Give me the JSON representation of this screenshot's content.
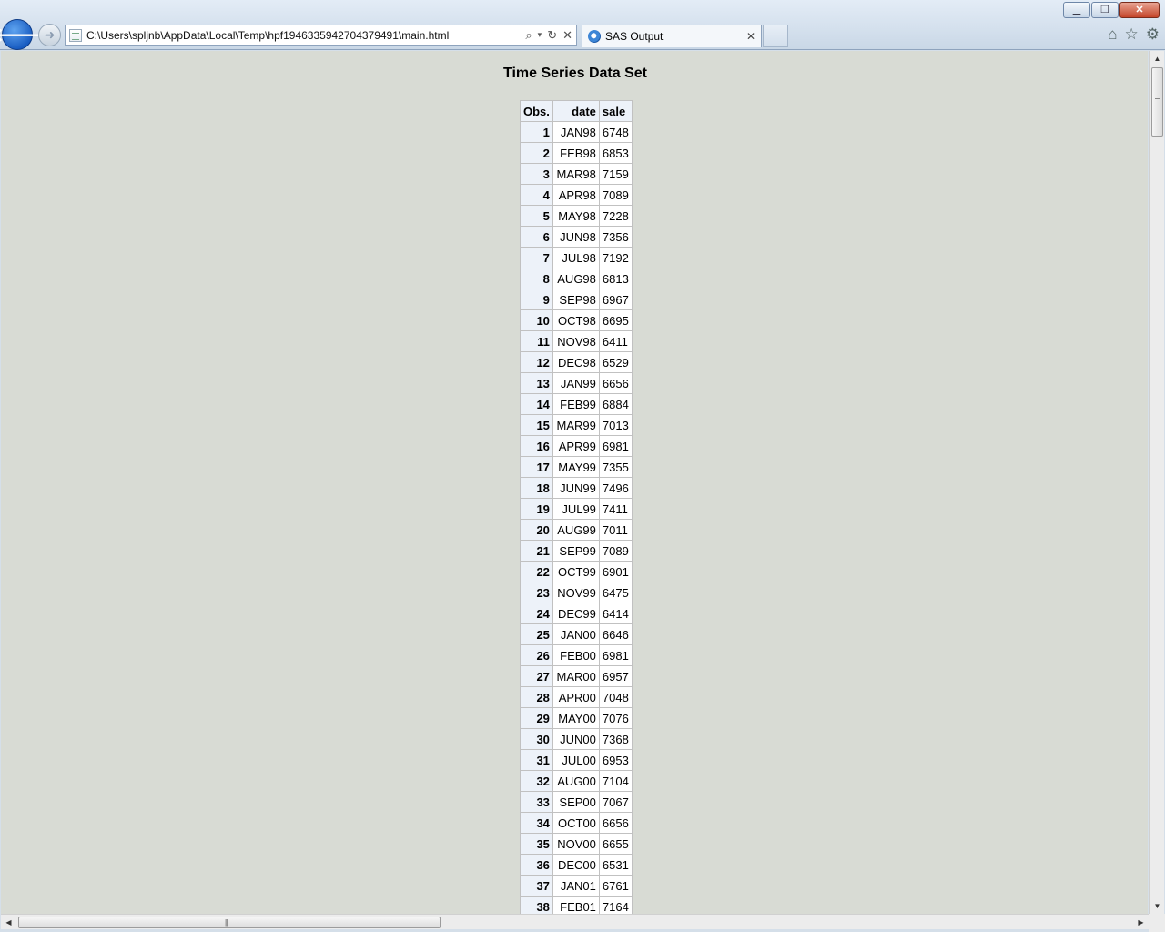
{
  "browser": {
    "address": "C:\\Users\\spljnb\\AppData\\Local\\Temp\\hpf1946335942704379491\\main.html",
    "tab_title": "SAS Output"
  },
  "page": {
    "title": "Time Series Data Set"
  },
  "table": {
    "headers": [
      "Obs.",
      "date",
      "sale"
    ],
    "rows": [
      {
        "obs": "1",
        "date": "JAN98",
        "sale": "6748"
      },
      {
        "obs": "2",
        "date": "FEB98",
        "sale": "6853"
      },
      {
        "obs": "3",
        "date": "MAR98",
        "sale": "7159"
      },
      {
        "obs": "4",
        "date": "APR98",
        "sale": "7089"
      },
      {
        "obs": "5",
        "date": "MAY98",
        "sale": "7228"
      },
      {
        "obs": "6",
        "date": "JUN98",
        "sale": "7356"
      },
      {
        "obs": "7",
        "date": "JUL98",
        "sale": "7192"
      },
      {
        "obs": "8",
        "date": "AUG98",
        "sale": "6813"
      },
      {
        "obs": "9",
        "date": "SEP98",
        "sale": "6967"
      },
      {
        "obs": "10",
        "date": "OCT98",
        "sale": "6695"
      },
      {
        "obs": "11",
        "date": "NOV98",
        "sale": "6411"
      },
      {
        "obs": "12",
        "date": "DEC98",
        "sale": "6529"
      },
      {
        "obs": "13",
        "date": "JAN99",
        "sale": "6656"
      },
      {
        "obs": "14",
        "date": "FEB99",
        "sale": "6884"
      },
      {
        "obs": "15",
        "date": "MAR99",
        "sale": "7013"
      },
      {
        "obs": "16",
        "date": "APR99",
        "sale": "6981"
      },
      {
        "obs": "17",
        "date": "MAY99",
        "sale": "7355"
      },
      {
        "obs": "18",
        "date": "JUN99",
        "sale": "7496"
      },
      {
        "obs": "19",
        "date": "JUL99",
        "sale": "7411"
      },
      {
        "obs": "20",
        "date": "AUG99",
        "sale": "7011"
      },
      {
        "obs": "21",
        "date": "SEP99",
        "sale": "7089"
      },
      {
        "obs": "22",
        "date": "OCT99",
        "sale": "6901"
      },
      {
        "obs": "23",
        "date": "NOV99",
        "sale": "6475"
      },
      {
        "obs": "24",
        "date": "DEC99",
        "sale": "6414"
      },
      {
        "obs": "25",
        "date": "JAN00",
        "sale": "6646"
      },
      {
        "obs": "26",
        "date": "FEB00",
        "sale": "6981"
      },
      {
        "obs": "27",
        "date": "MAR00",
        "sale": "6957"
      },
      {
        "obs": "28",
        "date": "APR00",
        "sale": "7048"
      },
      {
        "obs": "29",
        "date": "MAY00",
        "sale": "7076"
      },
      {
        "obs": "30",
        "date": "JUN00",
        "sale": "7368"
      },
      {
        "obs": "31",
        "date": "JUL00",
        "sale": "6953"
      },
      {
        "obs": "32",
        "date": "AUG00",
        "sale": "7104"
      },
      {
        "obs": "33",
        "date": "SEP00",
        "sale": "7067"
      },
      {
        "obs": "34",
        "date": "OCT00",
        "sale": "6656"
      },
      {
        "obs": "35",
        "date": "NOV00",
        "sale": "6655"
      },
      {
        "obs": "36",
        "date": "DEC00",
        "sale": "6531"
      },
      {
        "obs": "37",
        "date": "JAN01",
        "sale": "6761"
      },
      {
        "obs": "38",
        "date": "FEB01",
        "sale": "7164"
      }
    ]
  },
  "icons": {
    "back": "back-arrow-icon",
    "forward": "forward-arrow-icon",
    "search": "search-icon",
    "refresh": "refresh-icon",
    "stop": "stop-icon",
    "home": "home-icon",
    "favorites": "star-icon",
    "tools": "gear-icon"
  },
  "colors": {
    "page_background": "#d8dbd4",
    "header_background": "#edf2f9",
    "cell_background": "#ffffff",
    "back_button": "#1559bf"
  }
}
